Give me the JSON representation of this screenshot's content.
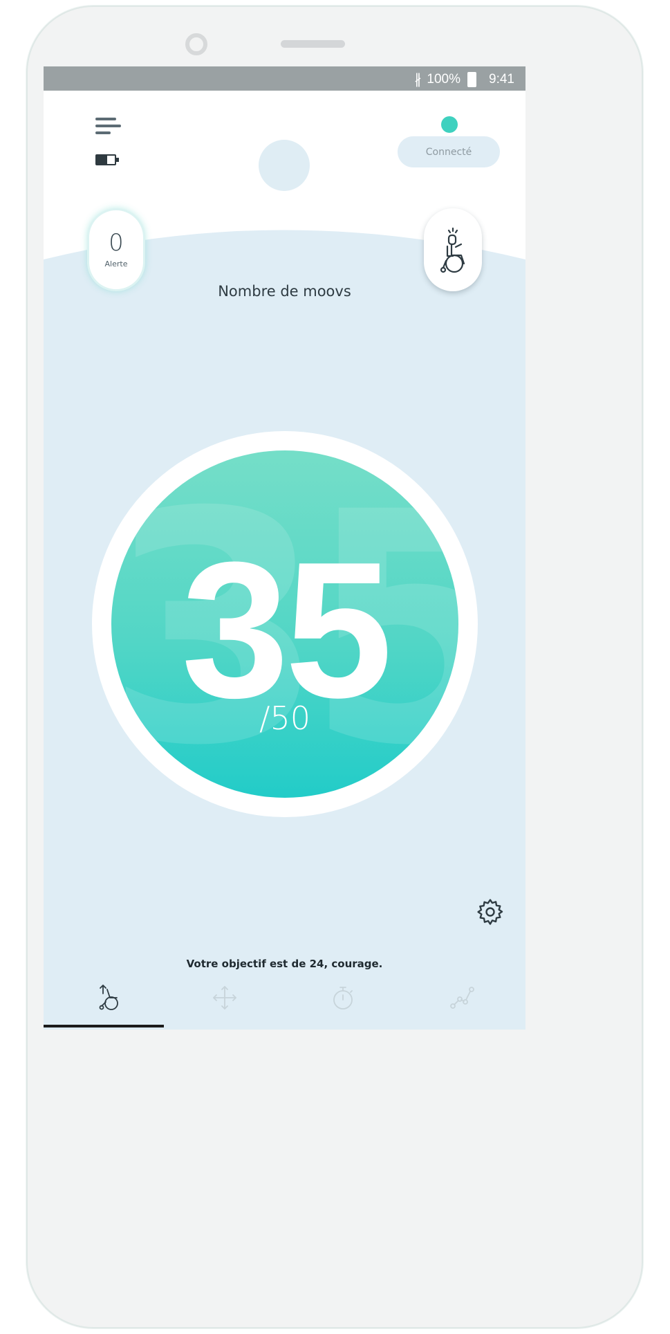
{
  "status_bar": {
    "icons": [
      "bluetooth-icon",
      "battery-icon"
    ],
    "battery_percent": "100%",
    "time": "9:41"
  },
  "header": {
    "icons": [
      "menu-icon",
      "device-battery-icon",
      "avatar"
    ],
    "connection_status": "Connecté",
    "colors": {
      "connected_dot": "#3fd1bf",
      "pill_bg": "#e0edf5"
    }
  },
  "alerts": {
    "count": "0",
    "label": "Alerte"
  },
  "posture_button": {
    "icon": "wheelchair-icon"
  },
  "moovs": {
    "title": "Nombre de moovs",
    "count": "35",
    "goal": "/50",
    "colors": {
      "disc_top": "#75dec8",
      "disc_bottom": "#22ccc8"
    }
  },
  "settings": {
    "icon": "gear-icon"
  },
  "objective_text": "Votre objectif est de 24, courage.",
  "tabs": [
    {
      "icon": "wheelchair-tilt-icon",
      "active": true
    },
    {
      "icon": "move-arrows-icon",
      "active": false
    },
    {
      "icon": "stopwatch-icon",
      "active": false
    },
    {
      "icon": "progress-chart-icon",
      "active": false
    }
  ],
  "colors": {
    "background": "#dfedf5",
    "text": "#2e3b42",
    "inactive_icon": "#c7d4da"
  }
}
